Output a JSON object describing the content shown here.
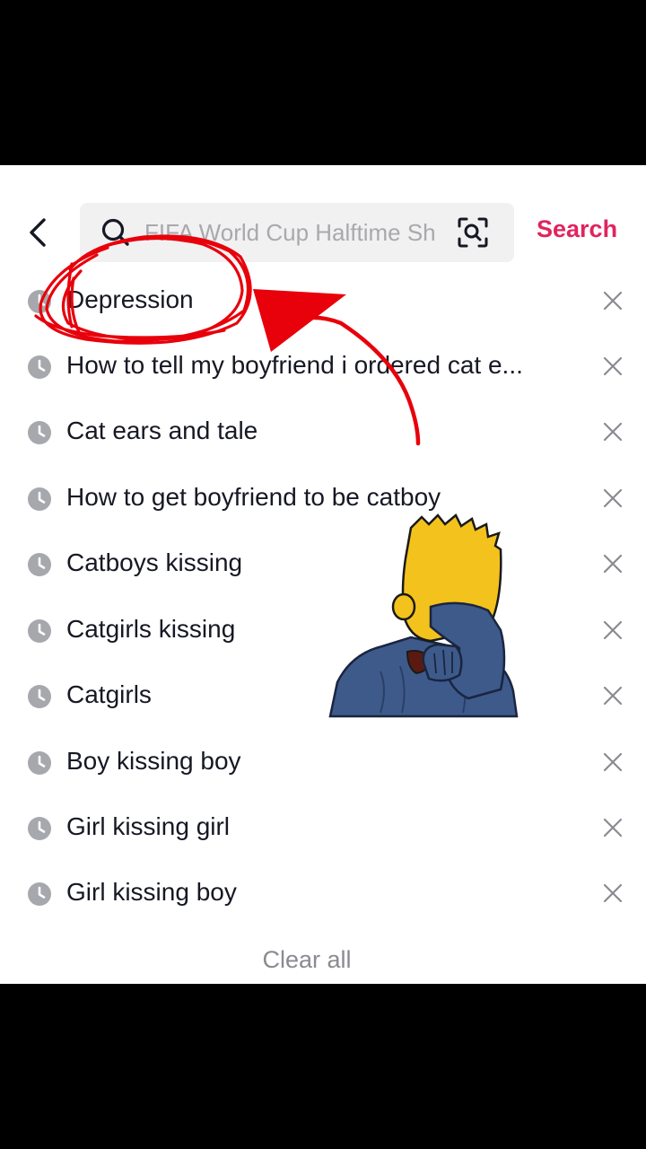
{
  "search": {
    "placeholder": "FIFA World Cup Halftime Sh",
    "button_label": "Search"
  },
  "history": [
    {
      "label": "Depression"
    },
    {
      "label": "How to tell my boyfriend i ordered cat e..."
    },
    {
      "label": "Cat ears and tale"
    },
    {
      "label": "How to get boyfriend to be catboy"
    },
    {
      "label": "Catboys kissing"
    },
    {
      "label": "Catgirls kissing"
    },
    {
      "label": "Catgirls"
    },
    {
      "label": "Boy kissing boy"
    },
    {
      "label": "Girl kissing girl"
    },
    {
      "label": "Girl kissing boy"
    }
  ],
  "clear_all_label": "Clear all",
  "colors": {
    "accent": "#e0245e",
    "annotation": "#e8000b",
    "icon_gray": "#8a8b91"
  },
  "icons": {
    "back": "chevron-left-icon",
    "search": "search-icon",
    "scan": "image-search-icon",
    "history": "clock-icon",
    "remove": "close-icon"
  }
}
